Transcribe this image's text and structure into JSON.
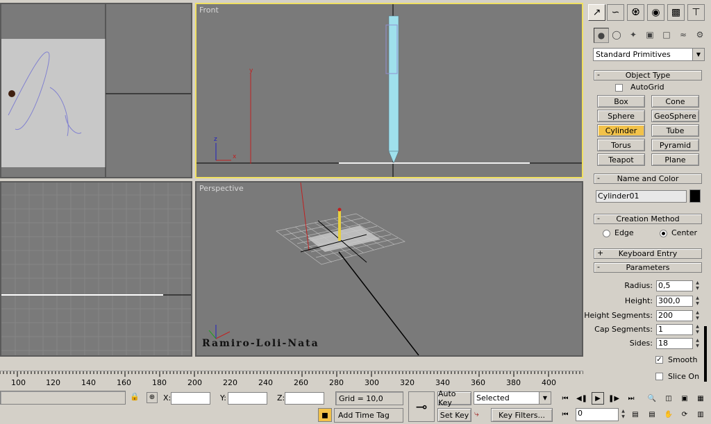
{
  "viewports": {
    "front": {
      "label": "Front"
    },
    "perspective": {
      "label": "Perspective"
    },
    "perspective_watermark": "Ramiro-Loli-Nata"
  },
  "command_panel": {
    "category_dropdown": "Standard Primitives",
    "object_type": {
      "title": "Object Type",
      "autogrid_label": "AutoGrid",
      "buttons": [
        "Box",
        "Cone",
        "Sphere",
        "GeoSphere",
        "Cylinder",
        "Tube",
        "Torus",
        "Pyramid",
        "Teapot",
        "Plane"
      ],
      "active": "Cylinder"
    },
    "name_and_color": {
      "title": "Name and Color",
      "name": "Cylinder01",
      "color": "#000000"
    },
    "creation_method": {
      "title": "Creation Method",
      "edge_label": "Edge",
      "center_label": "Center",
      "selected": "Center"
    },
    "keyboard_entry": {
      "title": "Keyboard Entry"
    },
    "parameters": {
      "title": "Parameters",
      "radius_label": "Radius:",
      "radius": "0,5",
      "height_label": "Height:",
      "height": "300,0",
      "height_segments_label": "Height Segments:",
      "height_segments": "200",
      "cap_segments_label": "Cap Segments:",
      "cap_segments": "1",
      "sides_label": "Sides:",
      "sides": "18",
      "smooth_label": "Smooth",
      "slice_on_label": "Slice On"
    }
  },
  "timeline": {
    "ticks": [
      "100",
      "120",
      "140",
      "160",
      "180",
      "200",
      "220",
      "240",
      "260",
      "280",
      "300",
      "320",
      "340",
      "360",
      "380",
      "400"
    ]
  },
  "status_bar": {
    "x_label": "X:",
    "y_label": "Y:",
    "z_label": "Z:",
    "grid": "Grid = 10,0",
    "add_time_tag": "Add Time Tag",
    "auto_key": "Auto Key",
    "set_key": "Set Key",
    "selected_dropdown": "Selected",
    "key_filters": "Key Filters...",
    "frame": "0"
  },
  "colors": {
    "active_viewport": "#f0e060",
    "active_button": "#f2c24a",
    "pencil": "#9fe0ec"
  }
}
